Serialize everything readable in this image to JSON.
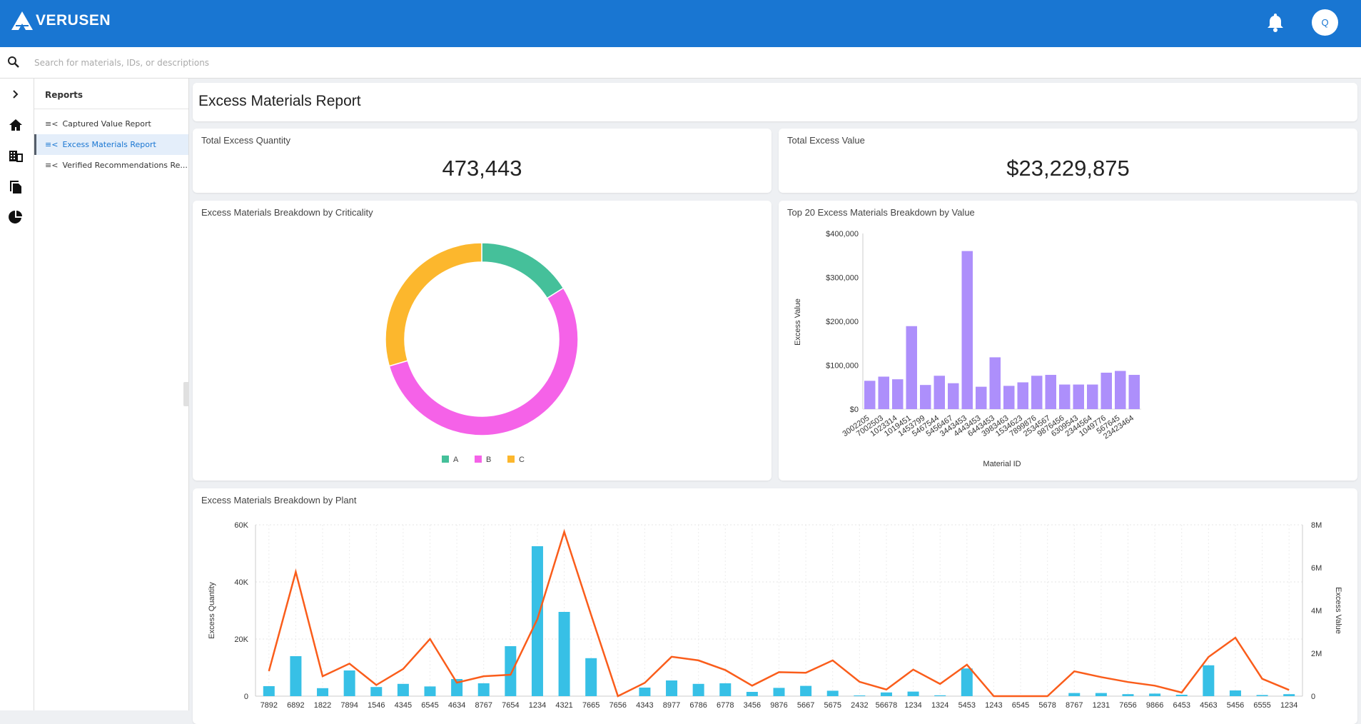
{
  "header": {
    "brand": "VERUSEN",
    "avatar_initial": "Q",
    "icons": [
      "bell-icon"
    ]
  },
  "search": {
    "placeholder": "Search for materials, IDs, or descriptions",
    "value": ""
  },
  "rail": {
    "icons": [
      "chevron-right-icon",
      "home-icon",
      "building-icon",
      "documents-icon",
      "pie-chart-icon"
    ]
  },
  "panel": {
    "title": "Reports",
    "items": [
      {
        "label": "Captured Value Report",
        "active": false
      },
      {
        "label": "Excess Materials Report",
        "active": true
      },
      {
        "label": "Verified Recommendations Re...",
        "active": false
      }
    ]
  },
  "page": {
    "title": "Excess Materials Report"
  },
  "kpis": [
    {
      "label": "Total Excess Quantity",
      "value": "473,443"
    },
    {
      "label": "Total Excess Value",
      "value": "$23,229,875"
    }
  ],
  "colors": {
    "brand": "#1976d2",
    "A": "#45c09a",
    "B": "#f562e8",
    "C": "#fcb72d",
    "bar_purple": "#ad8ffb",
    "bar_blue": "#37c0e6",
    "line_orange": "#fa5d1b"
  },
  "chart_data": [
    {
      "type": "pie",
      "donut": true,
      "title": "Excess Materials Breakdown by Criticality",
      "legend": "bottom",
      "categories": [
        "A",
        "B",
        "C"
      ],
      "values": [
        16.1,
        54.4,
        29.5
      ]
    },
    {
      "type": "bar",
      "title": "Top 20 Excess Materials Breakdown by Value",
      "xlabel": "Material ID",
      "ylabel": "Excess Value",
      "ylim": [
        0,
        400000
      ],
      "yticks": [
        "$0",
        "$100,000",
        "$200,000",
        "$300,000",
        "$400,000"
      ],
      "categories": [
        "3002205",
        "7002503",
        "1023314",
        "1019451",
        "1453799",
        "5467544",
        "5456467",
        "3443453",
        "4443453",
        "6443453",
        "3983463",
        "1534623",
        "7899876",
        "2534567",
        "9876456",
        "6309543",
        "2344564",
        "1049776",
        "567645",
        "23423464"
      ],
      "values": [
        64500,
        74000,
        68000,
        189000,
        55000,
        76000,
        59000,
        360000,
        51000,
        118000,
        53000,
        61000,
        76000,
        78000,
        56000,
        56000,
        56000,
        83000,
        87000,
        78000
      ]
    },
    {
      "type": "bar+line",
      "title": "Excess Materials Breakdown by Plant",
      "ylabel": "Excess Quantity",
      "y2label": "Excess Value",
      "ylim": [
        0,
        60000
      ],
      "y2lim": [
        0,
        8000000
      ],
      "yticks": [
        "0",
        "20K",
        "40K",
        "60K"
      ],
      "y2ticks": [
        "0",
        "2M",
        "4M",
        "6M",
        "8M"
      ],
      "grid": true,
      "categories": [
        "7892",
        "6892",
        "1822",
        "7894",
        "1546",
        "4345",
        "6545",
        "4634",
        "8767",
        "7654",
        "1234",
        "4321",
        "7665",
        "7656",
        "4343",
        "8977",
        "6786",
        "6778",
        "3456",
        "9876",
        "5667",
        "5675",
        "2432",
        "56678",
        "1234",
        "1324",
        "5453",
        "1243",
        "6545",
        "5678",
        "8767",
        "1231",
        "7656",
        "9866",
        "6453",
        "4563",
        "5456",
        "6555",
        "1234"
      ],
      "series": [
        {
          "name": "Excess Quantity",
          "type": "bar",
          "values": [
            3500,
            14000,
            2800,
            9000,
            3200,
            4300,
            3400,
            6000,
            4500,
            17500,
            52500,
            29500,
            13300,
            0,
            3000,
            5500,
            4300,
            4500,
            1500,
            2900,
            3600,
            1900,
            250,
            1300,
            1600,
            300,
            9700,
            0,
            0,
            0,
            1100,
            1100,
            700,
            900,
            500,
            10800,
            2000,
            400,
            700
          ]
        },
        {
          "name": "Excess Value",
          "type": "line",
          "values": [
            1170000,
            5800000,
            930000,
            1520000,
            520000,
            1270000,
            2670000,
            630000,
            930000,
            1000000,
            3600000,
            7670000,
            3800000,
            0,
            620000,
            1840000,
            1670000,
            1220000,
            490000,
            1120000,
            1090000,
            1670000,
            670000,
            310000,
            1240000,
            570000,
            1470000,
            0,
            0,
            0,
            1160000,
            890000,
            660000,
            490000,
            170000,
            1830000,
            2730000,
            810000,
            290000
          ]
        }
      ]
    }
  ]
}
